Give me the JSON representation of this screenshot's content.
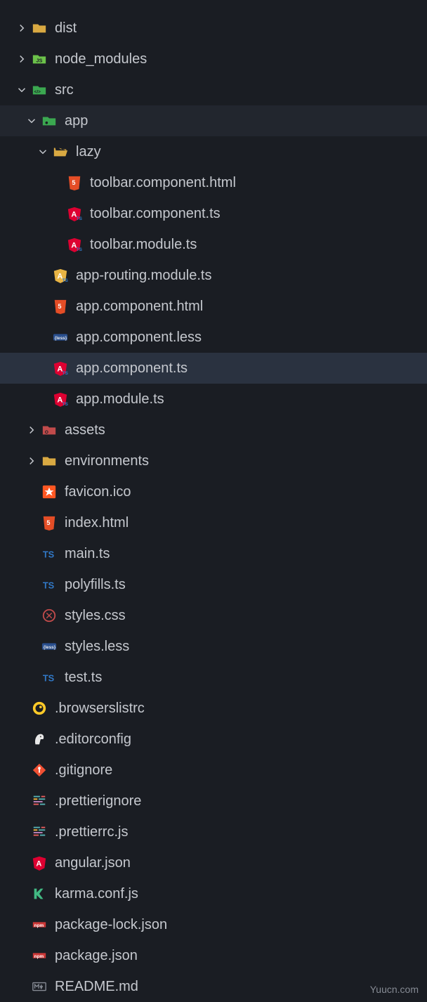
{
  "tree": {
    "dist": "dist",
    "node_modules": "node_modules",
    "src": "src",
    "app": "app",
    "lazy": "lazy",
    "toolbar_html": "toolbar.component.html",
    "toolbar_ts": "toolbar.component.ts",
    "toolbar_module": "toolbar.module.ts",
    "app_routing": "app-routing.module.ts",
    "app_html": "app.component.html",
    "app_less": "app.component.less",
    "app_ts": "app.component.ts",
    "app_module": "app.module.ts",
    "assets": "assets",
    "environments": "environments",
    "favicon": "favicon.ico",
    "index_html": "index.html",
    "main_ts": "main.ts",
    "polyfills": "polyfills.ts",
    "styles_css": "styles.css",
    "styles_less": "styles.less",
    "test_ts": "test.ts",
    "browserslistrc": ".browserslistrc",
    "editorconfig": ".editorconfig",
    "gitignore": ".gitignore",
    "prettierignore": ".prettierignore",
    "prettierrc": ".prettierrc.js",
    "angular_json": "angular.json",
    "karma_conf": "karma.conf.js",
    "package_lock": "package-lock.json",
    "package_json": "package.json",
    "readme": "README.md"
  },
  "watermark": "Yuucn.com"
}
